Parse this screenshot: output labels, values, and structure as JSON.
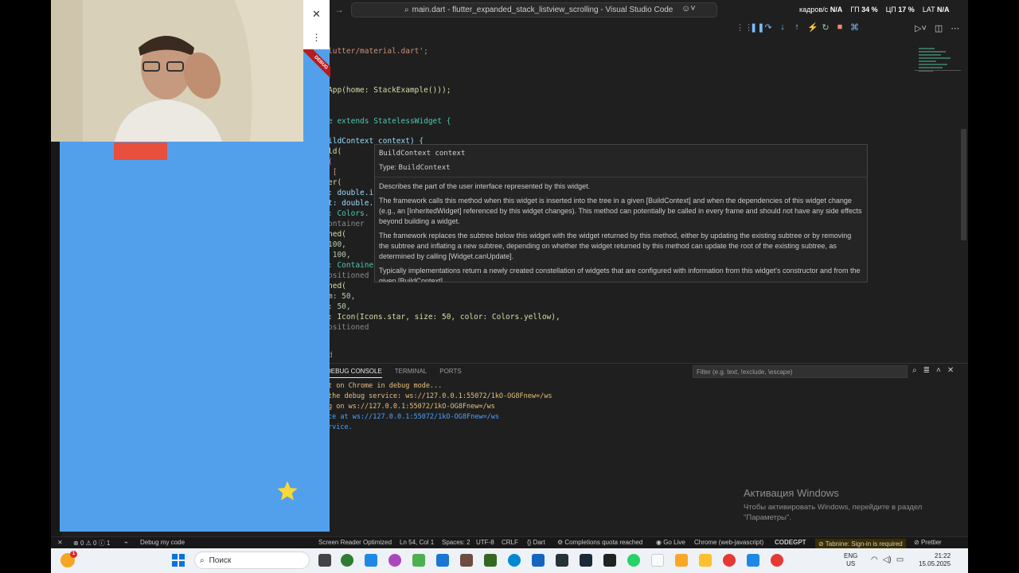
{
  "titlebar": {
    "search_text": "main.dart - flutter_expanded_stack_listview_scrolling - Visual Studio Code",
    "perf": [
      {
        "label": "кадров/с",
        "value": "N/A"
      },
      {
        "label": "ГП",
        "value": "34 %"
      },
      {
        "label": "ЦП",
        "value": "17 %"
      },
      {
        "label": "LAT",
        "value": "N/A"
      }
    ]
  },
  "editor": {
    "lines": [
      {
        "text": "lutter/material.dart';"
      },
      {
        "text": "App(home: StackExample()));"
      },
      {
        "text": "e extends StatelessWidget {"
      },
      {
        "text": "ildContext context) {"
      },
      {
        "text": "ld("
      },
      {
        "text": "("
      },
      {
        "text": " ["
      },
      {
        "text": "er("
      },
      {
        "text": ": double.in"
      },
      {
        "text": "t: double.i"
      },
      {
        "text": ": Colors."
      },
      {
        "text": "ontainer"
      },
      {
        "text": "ned("
      },
      {
        "text": "100,"
      },
      {
        "text": " 100,"
      },
      {
        "text": ": Container"
      },
      {
        "text": "ositioned"
      },
      {
        "text": "ned("
      },
      {
        "text": "m: 50,"
      },
      {
        "text": ": 50,"
      },
      {
        "text": ": Icon(Icons.star, size: 50, color: Colors.yellow),"
      },
      {
        "text": "ositioned"
      },
      {
        "text": "d"
      }
    ]
  },
  "hover": {
    "signature": "BuildContext context",
    "type_label": "Type:",
    "type_value": "BuildContext",
    "paragraphs": [
      "Describes the part of the user interface represented by this widget.",
      "The framework calls this method when this widget is inserted into the tree in a given [BuildContext] and when the dependencies of this widget change (e.g., an [InheritedWidget] referenced by this widget changes). This method can potentially be called in every frame and should not have any side effects beyond building a widget.",
      "The framework replaces the subtree below this widget with the widget returned by this method, either by updating the existing subtree or by removing the subtree and inflating a new subtree, depending on whether the widget returned by this method can update the root of the existing subtree, as determined by calling [Widget.canUpdate].",
      "Typically implementations return a newly created constellation of widgets that are configured with information from this widget's constructor and from the given [BuildContext]."
    ]
  },
  "panel": {
    "tabs": [
      "DEBUG CONSOLE",
      "TERMINAL",
      "PORTS"
    ],
    "filter_placeholder": "Filter (e.g. text, !exclude, \\escape)",
    "console": [
      "t on Chrome in debug mode...",
      "the debug service: ws://127.0.0.1:55072/1kO-OG8Fnew=/ws",
      "g on ws://127.0.0.1:55072/1kO-OG8Fnew=/ws",
      "ce at ws://127.0.0.1:55072/1kO-OG8Fnew=/ws",
      "rvice."
    ],
    "colors": {
      "yellow": "#e5c07b",
      "blue": "#4aa3ff"
    }
  },
  "activation": {
    "title": "Активация Windows",
    "text": "Чтобы активировать Windows, перейдите в раздел \"Параметры\"."
  },
  "statusbar": {
    "errors": "0",
    "warnings": "0",
    "info": "1",
    "debug": "Debug my code",
    "screen_reader": "Screen Reader Optimized",
    "position": "Ln 54, Col 1",
    "spaces": "Spaces: 2",
    "encoding": "UTF-8",
    "eol": "CRLF",
    "language": "Dart",
    "quota": "Completions quota reached",
    "golive": "Go Live",
    "device": "Chrome (web-javascript)",
    "codegpt": "CODEGPT",
    "tabnine": "Tabnine: Sign-in is required",
    "prettier": "Prettier"
  },
  "taskbar": {
    "search": "Поиск",
    "lang_top": "ENG",
    "lang_bottom": "US",
    "time": "21:22",
    "date": "15.05.2025",
    "weather_badge": "1"
  },
  "app": {
    "debug_banner": "DEBUG",
    "colors": {
      "background": "#52a0ec",
      "box": "#e84f3d",
      "star": "#fdd835"
    }
  }
}
